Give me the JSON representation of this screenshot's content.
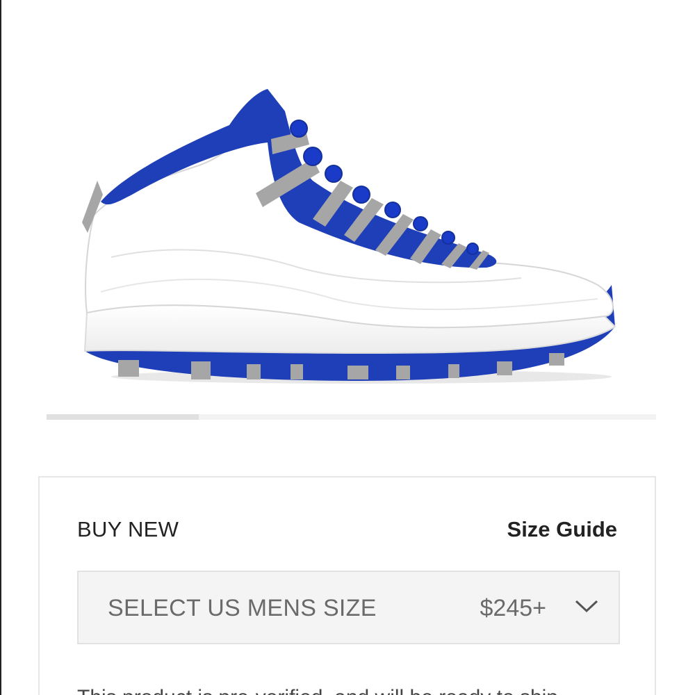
{
  "product": {
    "image_alt": "sneaker-image",
    "colors": {
      "primary": "#1f3fb8",
      "secondary": "#ffffff",
      "accent": "#a6a6a6"
    }
  },
  "carousel": {
    "progress_fraction": 0.25
  },
  "buy_panel": {
    "heading": "BUY NEW",
    "size_guide_label": "Size Guide",
    "size_select": {
      "placeholder": "SELECT US MENS SIZE",
      "price": "$245+",
      "icon": "chevron-down-icon"
    },
    "info_text": "This product is pre-verified, and will be ready to ship"
  }
}
